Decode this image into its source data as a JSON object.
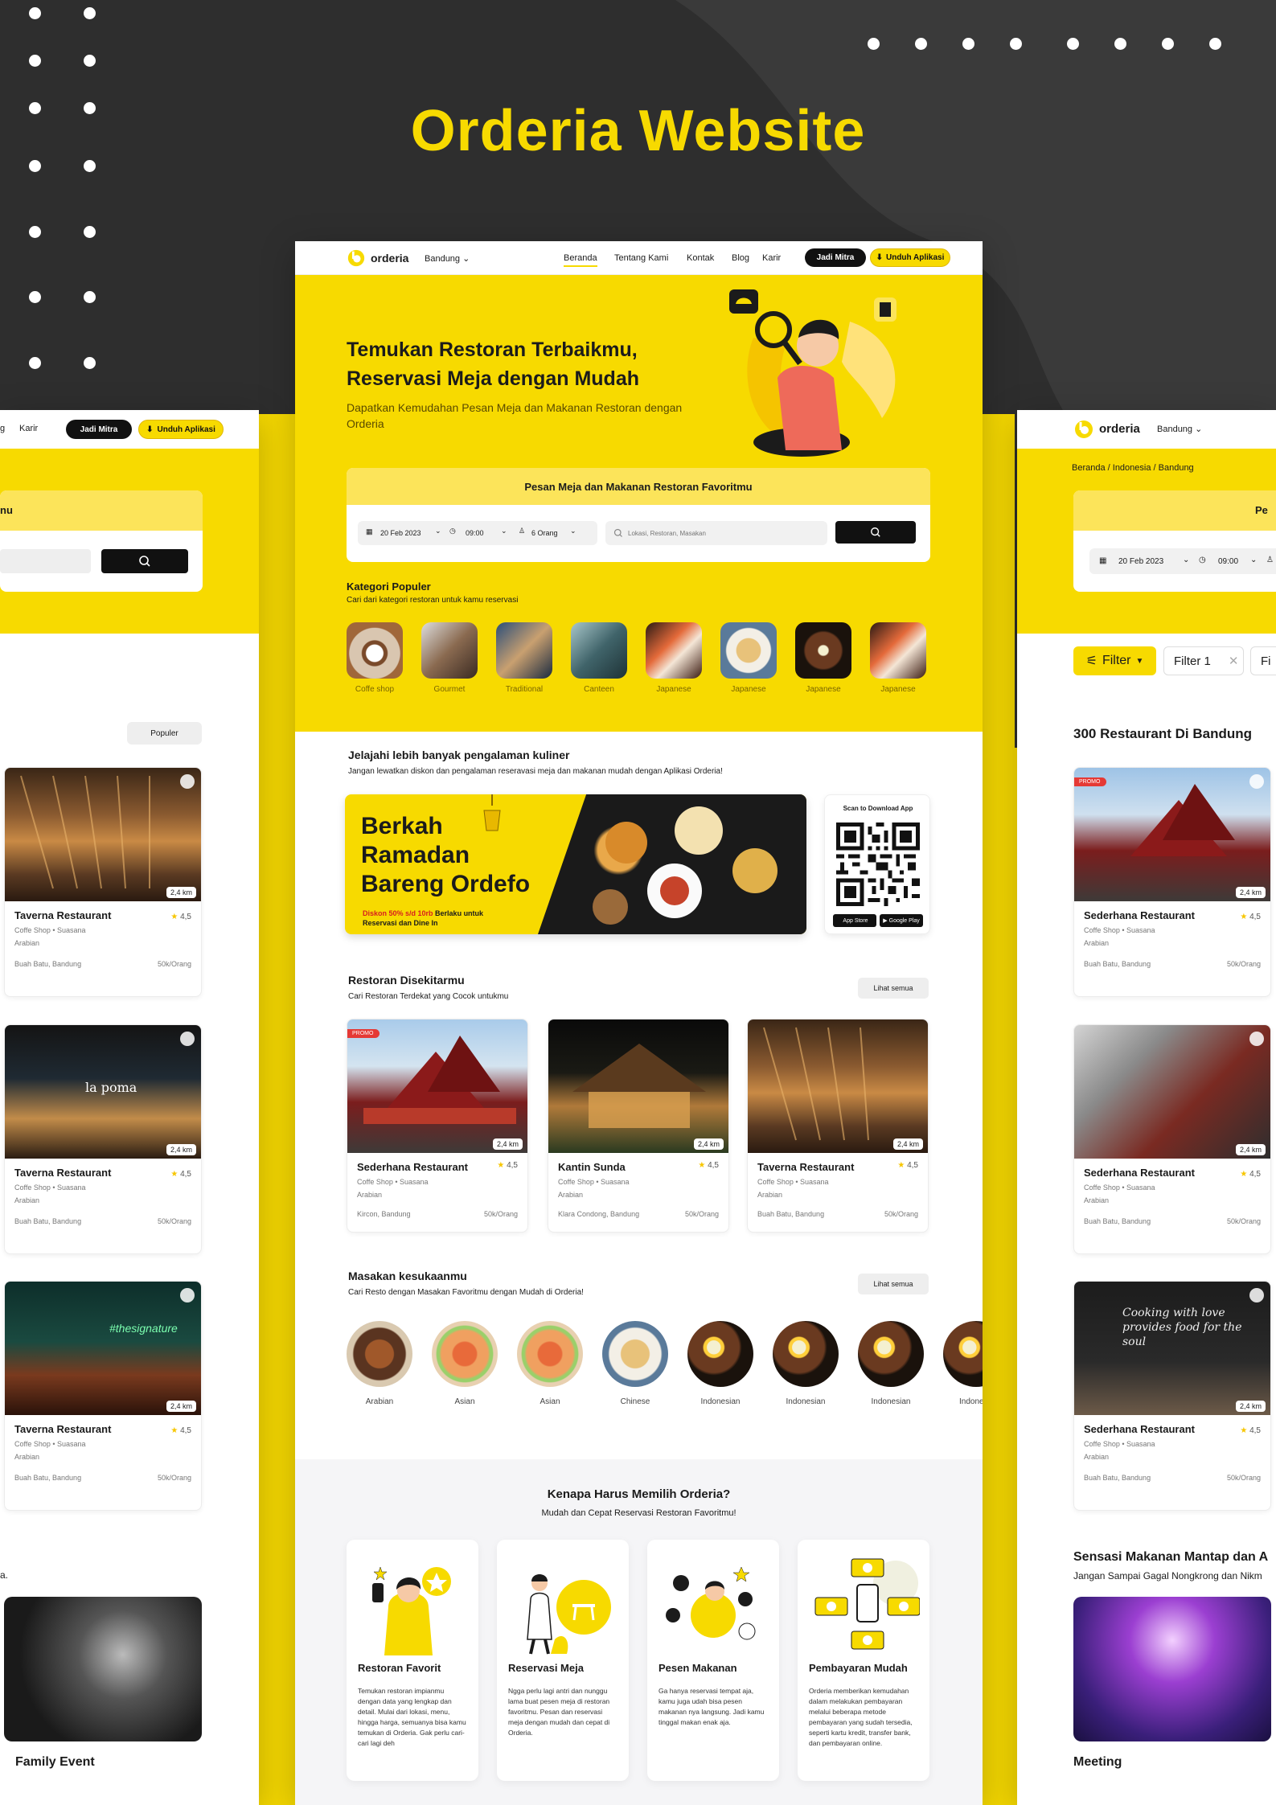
{
  "showcase": {
    "title": "Orderia Website"
  },
  "brand": {
    "name": "orderia",
    "accent": "#F7DA00",
    "dark": "#2E2E2E"
  },
  "nav": {
    "city": "Bandung",
    "links": [
      "Beranda",
      "Tentang Kami",
      "Kontak",
      "Blog",
      "Karir"
    ],
    "mitra_button": "Jadi Mitra",
    "download_button": "Unduh Aplikasi"
  },
  "hero": {
    "title_line1": "Temukan Restoran Terbaikmu,",
    "title_line2": "Reservasi Meja dengan Mudah",
    "subtitle": "Dapatkan Kemudahan Pesan Meja dan Makanan Restoran dengan Orderia"
  },
  "search": {
    "header": "Pesan Meja dan Makanan Restoran Favoritmu",
    "date": "20 Feb 2023",
    "time": "09:00",
    "guests": "6 Orang",
    "placeholder": "Lokasi, Restoran, Masakan"
  },
  "categories": {
    "title": "Kategori Populer",
    "subtitle": "Cari dari kategori restoran untuk kamu reservasi",
    "items": [
      "Coffe shop",
      "Gourmet",
      "Traditional",
      "Canteen",
      "Japanese",
      "Japanese",
      "Japanese",
      "Japanese"
    ]
  },
  "promo_section": {
    "title": "Jelajahi lebih banyak pengalaman kuliner",
    "subtitle": "Jangan lewatkan diskon dan pengalaman reseravasi meja dan makanan mudah dengan Aplikasi Orderia!",
    "banner_l1": "Berkah",
    "banner_l2": "Ramadan",
    "banner_l3": "Bareng Ordefo",
    "banner_red": "Diskon 50% s/d 10rb",
    "banner_rest": " Berlaku untuk",
    "banner_l5": "Reservasi dan Dine In",
    "qr_label": "Scan to Download App",
    "appstore": "App Store",
    "googleplay": "Google Play"
  },
  "nearby": {
    "title": "Restoran Disekitarmu",
    "subtitle": "Cari Restoran Terdekat yang Cocok untukmu",
    "see_all": "Lihat semua",
    "promo_badge": "PROMO",
    "cards": [
      {
        "name": "Sederhana Restaurant",
        "rating": "4,5",
        "tags": "Coffe Shop  •  Suasana",
        "tags2": "Arabian",
        "location": "Kircon, Bandung",
        "price": "50k/Orang",
        "distance": "2,4 km"
      },
      {
        "name": "Kantin Sunda",
        "rating": "4,5",
        "tags": "Coffe Shop  •  Suasana",
        "tags2": "Arabian",
        "location": "Klara Condong, Bandung",
        "price": "50k/Orang",
        "distance": "2,4 km"
      },
      {
        "name": "Taverna Restaurant",
        "rating": "4,5",
        "tags": "Coffe Shop  •  Suasana",
        "tags2": "Arabian",
        "location": "Buah Batu, Bandung",
        "price": "50k/Orang",
        "distance": "2,4 km"
      }
    ]
  },
  "cuisine": {
    "title": "Masakan kesukaanmu",
    "subtitle": "Cari Resto dengan Masakan Favoritmu dengan Mudah di Orderia!",
    "see_all": "Lihat semua",
    "items": [
      "Arabian",
      "Asian",
      "Asian",
      "Chinese",
      "Indonesian",
      "Indonesian",
      "Indonesian",
      "Indone"
    ]
  },
  "why": {
    "title": "Kenapa Harus Memilih Orderia?",
    "subtitle": "Mudah dan Cepat Reservasi Restoran Favoritmu!",
    "cards": [
      {
        "title": "Restoran Favorit",
        "text": "Temukan restoran impianmu dengan data yang lengkap dan detail. Mulai dari lokasi, menu, hingga harga, semuanya bisa kamu temukan di Orderia. Gak perlu cari-cari lagi deh"
      },
      {
        "title": "Reservasi Meja",
        "text": "Ngga perlu lagi antri dan nunggu lama buat pesen meja di restoran favoritmu. Pesan dan reservasi meja dengan mudah dan cepat di Orderia."
      },
      {
        "title": "Pesen Makanan",
        "text": "Ga hanya reservasi tempat aja, kamu juga udah bisa pesen makanan nya langsung. Jadi kamu tinggal makan enak aja."
      },
      {
        "title": "Pembayaran Mudah",
        "text": "Orderia memberikan kemudahan dalam melakukan pembayaran melalui beberapa metode pembayaran yang sudah tersedia, seperti kartu kredit, transfer bank, dan pembayaran online."
      }
    ]
  },
  "left_mock": {
    "nav_g": "g",
    "nav_karir": "Karir",
    "mitra": "Jadi Mitra",
    "download": "Unduh Aplikasi",
    "search_partial": "nu",
    "sort": "Populer",
    "cards": [
      {
        "name": "Taverna Restaurant",
        "rating": "4,5",
        "tags": "Coffe Shop  •  Suasana",
        "tags2": "Arabian",
        "location": "Buah Batu, Bandung",
        "price": "50k/Orang",
        "distance": "2,4 km"
      },
      {
        "name": "Taverna Restaurant",
        "rating": "4,5",
        "tags": "Coffe Shop  •  Suasana",
        "tags2": "Arabian",
        "location": "Buah Batu, Bandung",
        "price": "50k/Orang",
        "distance": "2,4 km",
        "sign": "la poma"
      },
      {
        "name": "Taverna Restaurant",
        "rating": "4,5",
        "tags": "Coffe Shop  •  Suasana",
        "tags2": "Arabian",
        "location": "Buah Batu, Bandung",
        "price": "50k/Orang",
        "distance": "2,4 km",
        "sign": "#thesignature"
      }
    ],
    "dot": "a.",
    "event": "Family Event"
  },
  "right_mock": {
    "brand": "orderia",
    "city": "Bandung",
    "breadcrumb": "Beranda / Indonesia / Bandung",
    "search_partial": "Pe",
    "date": "20 Feb 2023",
    "time": "09:00",
    "filter": "Filter",
    "filter1": "Filter 1",
    "filter_partial": "Fi",
    "count_title": "300 Restaurant Di Bandung",
    "promo_badge": "PROMO",
    "cards": [
      {
        "name": "Sederhana Restaurant",
        "rating": "4,5",
        "tags": "Coffe Shop  •  Suasana",
        "tags2": "Arabian",
        "location": "Buah Batu, Bandung",
        "price": "50k/Orang",
        "distance": "2,4 km"
      },
      {
        "name": "Sederhana Restaurant",
        "rating": "4,5",
        "tags": "Coffe Shop  •  Suasana",
        "tags2": "Arabian",
        "location": "Buah Batu, Bandung",
        "price": "50k/Orang",
        "distance": "2,4 km"
      },
      {
        "name": "Sederhana Restaurant",
        "rating": "4,5",
        "tags": "Coffe Shop  •  Suasana",
        "tags2": "Arabian",
        "location": "Buah Batu, Bandung",
        "price": "50k/Orang",
        "distance": "2,4 km",
        "sign": "Cooking with love provides food for the soul"
      }
    ],
    "section_title": "Sensasi Makanan Mantap dan A",
    "section_sub": "Jangan Sampai Gagal Nongkrong dan Nikm",
    "event": "Meeting"
  }
}
